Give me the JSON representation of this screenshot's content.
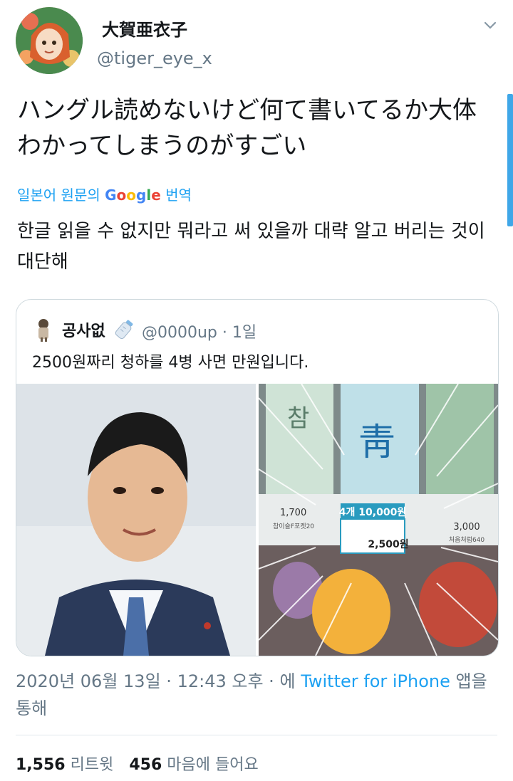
{
  "author": {
    "display_name": "大賀亜衣子",
    "handle": "@tiger_eye_x"
  },
  "tweet": {
    "text": "ハングル読めないけど何て書いてるか大体わかってしまうのがすごい",
    "translated_by": "일본어 원문의",
    "translator": "Google",
    "translated_suffix": "번역",
    "translation": "한글 읽을 수 없지만 뭐라고 써 있을까 대략 알고 버리는 것이 대단해"
  },
  "quote": {
    "name": "공사없",
    "handle": "@0000up",
    "separator": "·",
    "time": "1일",
    "text": "2500원짜리 청하를 4병 사면 만원입니다.",
    "price_tag": {
      "big": "4개 10,000원",
      "small": "2,500원",
      "left_price": "1,700",
      "left_name": "참이슬F포켓20",
      "right_price": "3,000",
      "right_name": "처음처럼640"
    }
  },
  "meta": {
    "date": "2020년 06월 13일",
    "sep1": "·",
    "time": "12:43 오후",
    "sep2": "·",
    "via_prefix": "에",
    "app": "Twitter for iPhone",
    "via_suffix": "앱을",
    "last_line": "통해"
  },
  "stats": {
    "retweets": "1,556",
    "retweets_label": "리트윗",
    "likes": "456",
    "likes_label": "마음에 들어요"
  },
  "colors": {
    "link": "#1da1f2",
    "secondary": "#657786",
    "border": "#cfd9de"
  }
}
